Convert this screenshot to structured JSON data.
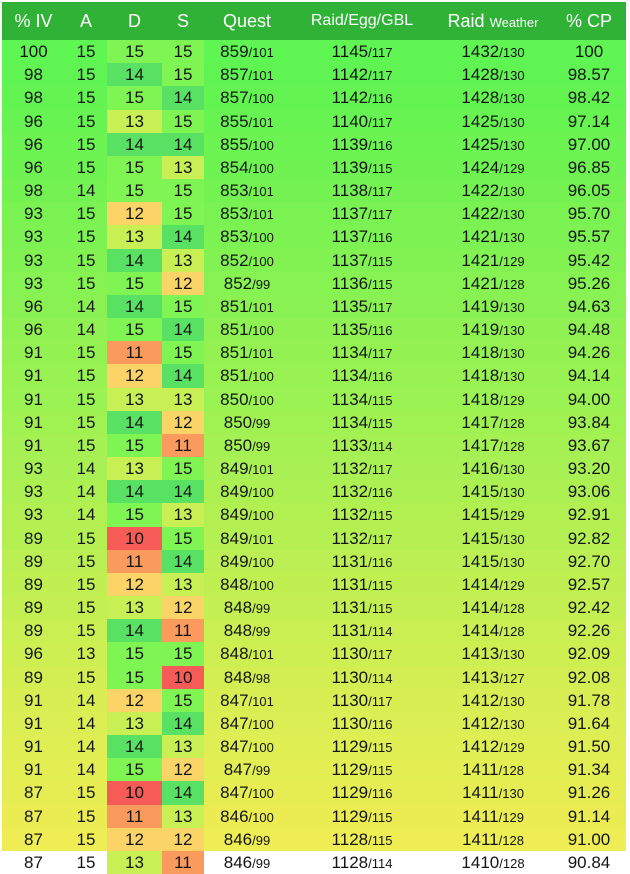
{
  "headers": {
    "iv": "% IV",
    "a": "A",
    "d": "D",
    "s": "S",
    "quest": "Quest",
    "raid": "Raid/Egg/GBL",
    "weather_main": "Raid",
    "weather_sub": "Weather",
    "cp": "% CP"
  },
  "row_shades": [
    "#5ff653",
    "#60f452",
    "#63f452",
    "#67f452",
    "#6bf452",
    "#6ff352",
    "#74f252",
    "#79f252",
    "#7cf352",
    "#81f252",
    "#86f352",
    "#8af152",
    "#8ff152",
    "#93f252",
    "#98f252",
    "#9bf253",
    "#a0f152",
    "#a5f153",
    "#a8f053",
    "#adf052",
    "#b2f052",
    "#b5f052",
    "#bcef53",
    "#c0ef52",
    "#c4ef52",
    "#caef53",
    "#cdef52",
    "#d2ee52",
    "#d8ee52",
    "#dbee53",
    "#deee53",
    "#e3ee53",
    "#e5ed53",
    "#eaec52",
    "#eeed53"
  ],
  "colors": {
    "15": "#7ef552",
    "14": "#58e163",
    "13": "#c8f054",
    "12": "#fad466",
    "11": "#fa9b5d",
    "10": "#f65b57"
  },
  "rows": [
    {
      "iv": "100",
      "a": "15",
      "d": "15",
      "s": "15",
      "quest": "859",
      "quest_l": "101",
      "raid": "1145",
      "raid_l": "117",
      "weather": "1432",
      "weather_l": "130",
      "cp": "100"
    },
    {
      "iv": "98",
      "a": "15",
      "d": "14",
      "s": "15",
      "quest": "857",
      "quest_l": "101",
      "raid": "1142",
      "raid_l": "117",
      "weather": "1428",
      "weather_l": "130",
      "cp": "98.57"
    },
    {
      "iv": "98",
      "a": "15",
      "d": "15",
      "s": "14",
      "quest": "857",
      "quest_l": "100",
      "raid": "1142",
      "raid_l": "116",
      "weather": "1428",
      "weather_l": "130",
      "cp": "98.42"
    },
    {
      "iv": "96",
      "a": "15",
      "d": "13",
      "s": "15",
      "quest": "855",
      "quest_l": "101",
      "raid": "1140",
      "raid_l": "117",
      "weather": "1425",
      "weather_l": "130",
      "cp": "97.14"
    },
    {
      "iv": "96",
      "a": "15",
      "d": "14",
      "s": "14",
      "quest": "855",
      "quest_l": "100",
      "raid": "1139",
      "raid_l": "116",
      "weather": "1425",
      "weather_l": "130",
      "cp": "97.00"
    },
    {
      "iv": "96",
      "a": "15",
      "d": "15",
      "s": "13",
      "quest": "854",
      "quest_l": "100",
      "raid": "1139",
      "raid_l": "115",
      "weather": "1424",
      "weather_l": "129",
      "cp": "96.85"
    },
    {
      "iv": "98",
      "a": "14",
      "d": "15",
      "s": "15",
      "quest": "853",
      "quest_l": "101",
      "raid": "1138",
      "raid_l": "117",
      "weather": "1422",
      "weather_l": "130",
      "cp": "96.05"
    },
    {
      "iv": "93",
      "a": "15",
      "d": "12",
      "s": "15",
      "quest": "853",
      "quest_l": "101",
      "raid": "1137",
      "raid_l": "117",
      "weather": "1422",
      "weather_l": "130",
      "cp": "95.70"
    },
    {
      "iv": "93",
      "a": "15",
      "d": "13",
      "s": "14",
      "quest": "853",
      "quest_l": "100",
      "raid": "1137",
      "raid_l": "116",
      "weather": "1421",
      "weather_l": "130",
      "cp": "95.57"
    },
    {
      "iv": "93",
      "a": "15",
      "d": "14",
      "s": "13",
      "quest": "852",
      "quest_l": "100",
      "raid": "1137",
      "raid_l": "115",
      "weather": "1421",
      "weather_l": "129",
      "cp": "95.42"
    },
    {
      "iv": "93",
      "a": "15",
      "d": "15",
      "s": "12",
      "quest": "852",
      "quest_l": "99",
      "raid": "1136",
      "raid_l": "115",
      "weather": "1421",
      "weather_l": "128",
      "cp": "95.26"
    },
    {
      "iv": "96",
      "a": "14",
      "d": "14",
      "s": "15",
      "quest": "851",
      "quest_l": "101",
      "raid": "1135",
      "raid_l": "117",
      "weather": "1419",
      "weather_l": "130",
      "cp": "94.63"
    },
    {
      "iv": "96",
      "a": "14",
      "d": "15",
      "s": "14",
      "quest": "851",
      "quest_l": "100",
      "raid": "1135",
      "raid_l": "116",
      "weather": "1419",
      "weather_l": "130",
      "cp": "94.48"
    },
    {
      "iv": "91",
      "a": "15",
      "d": "11",
      "s": "15",
      "quest": "851",
      "quest_l": "101",
      "raid": "1134",
      "raid_l": "117",
      "weather": "1418",
      "weather_l": "130",
      "cp": "94.26"
    },
    {
      "iv": "91",
      "a": "15",
      "d": "12",
      "s": "14",
      "quest": "851",
      "quest_l": "100",
      "raid": "1134",
      "raid_l": "116",
      "weather": "1418",
      "weather_l": "130",
      "cp": "94.14"
    },
    {
      "iv": "91",
      "a": "15",
      "d": "13",
      "s": "13",
      "quest": "850",
      "quest_l": "100",
      "raid": "1134",
      "raid_l": "115",
      "weather": "1418",
      "weather_l": "129",
      "cp": "94.00"
    },
    {
      "iv": "91",
      "a": "15",
      "d": "14",
      "s": "12",
      "quest": "850",
      "quest_l": "99",
      "raid": "1134",
      "raid_l": "115",
      "weather": "1417",
      "weather_l": "128",
      "cp": "93.84"
    },
    {
      "iv": "91",
      "a": "15",
      "d": "15",
      "s": "11",
      "quest": "850",
      "quest_l": "99",
      "raid": "1133",
      "raid_l": "114",
      "weather": "1417",
      "weather_l": "128",
      "cp": "93.67"
    },
    {
      "iv": "93",
      "a": "14",
      "d": "13",
      "s": "15",
      "quest": "849",
      "quest_l": "101",
      "raid": "1132",
      "raid_l": "117",
      "weather": "1416",
      "weather_l": "130",
      "cp": "93.20"
    },
    {
      "iv": "93",
      "a": "14",
      "d": "14",
      "s": "14",
      "quest": "849",
      "quest_l": "100",
      "raid": "1132",
      "raid_l": "116",
      "weather": "1415",
      "weather_l": "130",
      "cp": "93.06"
    },
    {
      "iv": "93",
      "a": "14",
      "d": "15",
      "s": "13",
      "quest": "849",
      "quest_l": "100",
      "raid": "1132",
      "raid_l": "115",
      "weather": "1415",
      "weather_l": "129",
      "cp": "92.91"
    },
    {
      "iv": "89",
      "a": "15",
      "d": "10",
      "s": "15",
      "quest": "849",
      "quest_l": "101",
      "raid": "1132",
      "raid_l": "117",
      "weather": "1415",
      "weather_l": "130",
      "cp": "92.82"
    },
    {
      "iv": "89",
      "a": "15",
      "d": "11",
      "s": "14",
      "quest": "849",
      "quest_l": "100",
      "raid": "1131",
      "raid_l": "116",
      "weather": "1415",
      "weather_l": "130",
      "cp": "92.70"
    },
    {
      "iv": "89",
      "a": "15",
      "d": "12",
      "s": "13",
      "quest": "848",
      "quest_l": "100",
      "raid": "1131",
      "raid_l": "115",
      "weather": "1414",
      "weather_l": "129",
      "cp": "92.57"
    },
    {
      "iv": "89",
      "a": "15",
      "d": "13",
      "s": "12",
      "quest": "848",
      "quest_l": "99",
      "raid": "1131",
      "raid_l": "115",
      "weather": "1414",
      "weather_l": "128",
      "cp": "92.42"
    },
    {
      "iv": "89",
      "a": "15",
      "d": "14",
      "s": "11",
      "quest": "848",
      "quest_l": "99",
      "raid": "1131",
      "raid_l": "114",
      "weather": "1414",
      "weather_l": "128",
      "cp": "92.26"
    },
    {
      "iv": "96",
      "a": "13",
      "d": "15",
      "s": "15",
      "quest": "848",
      "quest_l": "101",
      "raid": "1130",
      "raid_l": "117",
      "weather": "1413",
      "weather_l": "130",
      "cp": "92.09"
    },
    {
      "iv": "89",
      "a": "15",
      "d": "15",
      "s": "10",
      "quest": "848",
      "quest_l": "98",
      "raid": "1130",
      "raid_l": "114",
      "weather": "1413",
      "weather_l": "127",
      "cp": "92.08"
    },
    {
      "iv": "91",
      "a": "14",
      "d": "12",
      "s": "15",
      "quest": "847",
      "quest_l": "101",
      "raid": "1130",
      "raid_l": "117",
      "weather": "1412",
      "weather_l": "130",
      "cp": "91.78"
    },
    {
      "iv": "91",
      "a": "14",
      "d": "13",
      "s": "14",
      "quest": "847",
      "quest_l": "100",
      "raid": "1130",
      "raid_l": "116",
      "weather": "1412",
      "weather_l": "130",
      "cp": "91.64"
    },
    {
      "iv": "91",
      "a": "14",
      "d": "14",
      "s": "13",
      "quest": "847",
      "quest_l": "100",
      "raid": "1129",
      "raid_l": "115",
      "weather": "1412",
      "weather_l": "129",
      "cp": "91.50"
    },
    {
      "iv": "91",
      "a": "14",
      "d": "15",
      "s": "12",
      "quest": "847",
      "quest_l": "99",
      "raid": "1129",
      "raid_l": "115",
      "weather": "1411",
      "weather_l": "128",
      "cp": "91.34"
    },
    {
      "iv": "87",
      "a": "15",
      "d": "10",
      "s": "14",
      "quest": "847",
      "quest_l": "100",
      "raid": "1129",
      "raid_l": "116",
      "weather": "1411",
      "weather_l": "130",
      "cp": "91.26"
    },
    {
      "iv": "87",
      "a": "15",
      "d": "11",
      "s": "13",
      "quest": "846",
      "quest_l": "100",
      "raid": "1129",
      "raid_l": "115",
      "weather": "1411",
      "weather_l": "129",
      "cp": "91.14"
    },
    {
      "iv": "87",
      "a": "15",
      "d": "12",
      "s": "12",
      "quest": "846",
      "quest_l": "99",
      "raid": "1128",
      "raid_l": "115",
      "weather": "1411",
      "weather_l": "128",
      "cp": "91.00"
    },
    {
      "iv": "87",
      "a": "15",
      "d": "13",
      "s": "11",
      "quest": "846",
      "quest_l": "99",
      "raid": "1128",
      "raid_l": "114",
      "weather": "1410",
      "weather_l": "128",
      "cp": "90.84"
    }
  ]
}
